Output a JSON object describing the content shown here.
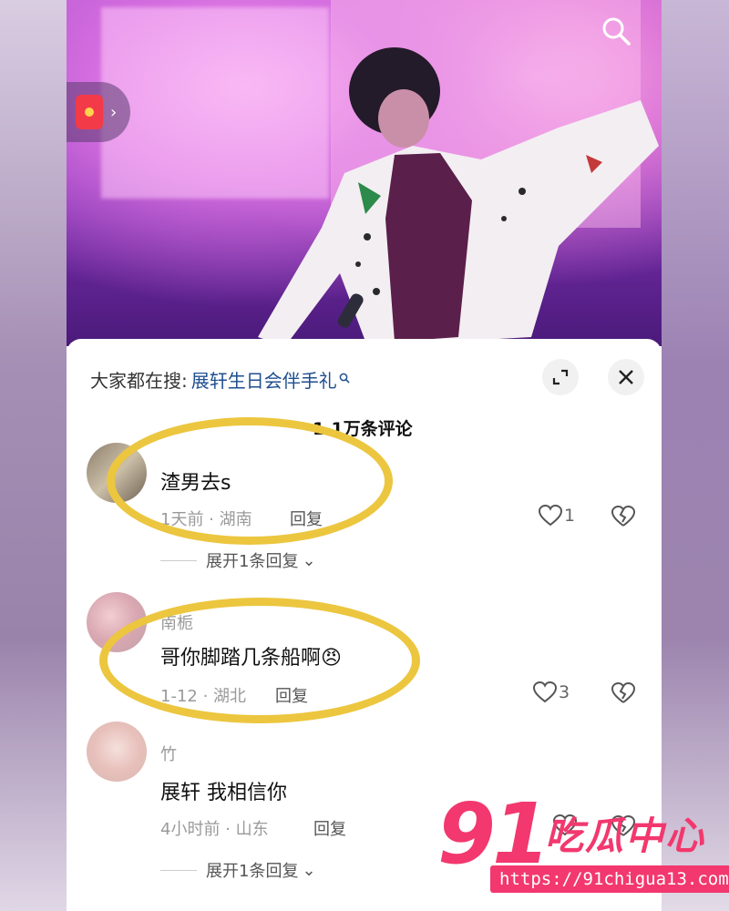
{
  "hot_search": {
    "prefix": "大家都在搜:",
    "term": "展轩生日会伴手礼",
    "search_icon": "search-icon"
  },
  "comments_count": "1.1万条评论",
  "comments": [
    {
      "username": "",
      "text": "渣男去s",
      "time_location": "1天前 · 湖南",
      "reply_label": "回复",
      "likes": "1",
      "expand_label": "展开1条回复"
    },
    {
      "username": "南栀",
      "text": "哥你脚踏几条船啊😠",
      "time_location": "1-12 · 湖北",
      "reply_label": "回复",
      "likes": "3",
      "expand_label": ""
    },
    {
      "username": "竹",
      "text": "展轩 我相信你",
      "time_location": "4小时前 · 山东",
      "reply_label": "回复",
      "likes": "",
      "expand_label": "展开1条回复"
    }
  ],
  "watermark": {
    "number": "91",
    "name": "吃瓜中心",
    "url": "https://91chigua13.com"
  },
  "colors": {
    "highlight_ring": "#ecc63f",
    "link_blue": "#1f4f8f",
    "watermark_pink": "#f2386e",
    "redpacket": "#f33a48"
  }
}
